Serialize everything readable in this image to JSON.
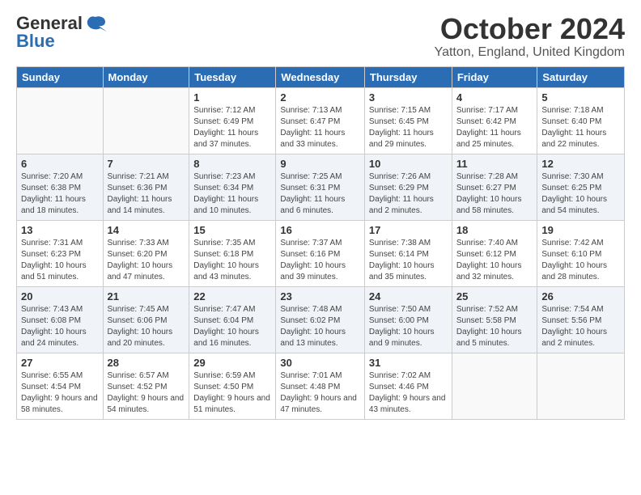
{
  "logo": {
    "general": "General",
    "blue": "Blue"
  },
  "header": {
    "month": "October 2024",
    "location": "Yatton, England, United Kingdom"
  },
  "weekdays": [
    "Sunday",
    "Monday",
    "Tuesday",
    "Wednesday",
    "Thursday",
    "Friday",
    "Saturday"
  ],
  "weeks": [
    [
      {
        "day": "",
        "info": ""
      },
      {
        "day": "",
        "info": ""
      },
      {
        "day": "1",
        "info": "Sunrise: 7:12 AM\nSunset: 6:49 PM\nDaylight: 11 hours and 37 minutes."
      },
      {
        "day": "2",
        "info": "Sunrise: 7:13 AM\nSunset: 6:47 PM\nDaylight: 11 hours and 33 minutes."
      },
      {
        "day": "3",
        "info": "Sunrise: 7:15 AM\nSunset: 6:45 PM\nDaylight: 11 hours and 29 minutes."
      },
      {
        "day": "4",
        "info": "Sunrise: 7:17 AM\nSunset: 6:42 PM\nDaylight: 11 hours and 25 minutes."
      },
      {
        "day": "5",
        "info": "Sunrise: 7:18 AM\nSunset: 6:40 PM\nDaylight: 11 hours and 22 minutes."
      }
    ],
    [
      {
        "day": "6",
        "info": "Sunrise: 7:20 AM\nSunset: 6:38 PM\nDaylight: 11 hours and 18 minutes."
      },
      {
        "day": "7",
        "info": "Sunrise: 7:21 AM\nSunset: 6:36 PM\nDaylight: 11 hours and 14 minutes."
      },
      {
        "day": "8",
        "info": "Sunrise: 7:23 AM\nSunset: 6:34 PM\nDaylight: 11 hours and 10 minutes."
      },
      {
        "day": "9",
        "info": "Sunrise: 7:25 AM\nSunset: 6:31 PM\nDaylight: 11 hours and 6 minutes."
      },
      {
        "day": "10",
        "info": "Sunrise: 7:26 AM\nSunset: 6:29 PM\nDaylight: 11 hours and 2 minutes."
      },
      {
        "day": "11",
        "info": "Sunrise: 7:28 AM\nSunset: 6:27 PM\nDaylight: 10 hours and 58 minutes."
      },
      {
        "day": "12",
        "info": "Sunrise: 7:30 AM\nSunset: 6:25 PM\nDaylight: 10 hours and 54 minutes."
      }
    ],
    [
      {
        "day": "13",
        "info": "Sunrise: 7:31 AM\nSunset: 6:23 PM\nDaylight: 10 hours and 51 minutes."
      },
      {
        "day": "14",
        "info": "Sunrise: 7:33 AM\nSunset: 6:20 PM\nDaylight: 10 hours and 47 minutes."
      },
      {
        "day": "15",
        "info": "Sunrise: 7:35 AM\nSunset: 6:18 PM\nDaylight: 10 hours and 43 minutes."
      },
      {
        "day": "16",
        "info": "Sunrise: 7:37 AM\nSunset: 6:16 PM\nDaylight: 10 hours and 39 minutes."
      },
      {
        "day": "17",
        "info": "Sunrise: 7:38 AM\nSunset: 6:14 PM\nDaylight: 10 hours and 35 minutes."
      },
      {
        "day": "18",
        "info": "Sunrise: 7:40 AM\nSunset: 6:12 PM\nDaylight: 10 hours and 32 minutes."
      },
      {
        "day": "19",
        "info": "Sunrise: 7:42 AM\nSunset: 6:10 PM\nDaylight: 10 hours and 28 minutes."
      }
    ],
    [
      {
        "day": "20",
        "info": "Sunrise: 7:43 AM\nSunset: 6:08 PM\nDaylight: 10 hours and 24 minutes."
      },
      {
        "day": "21",
        "info": "Sunrise: 7:45 AM\nSunset: 6:06 PM\nDaylight: 10 hours and 20 minutes."
      },
      {
        "day": "22",
        "info": "Sunrise: 7:47 AM\nSunset: 6:04 PM\nDaylight: 10 hours and 16 minutes."
      },
      {
        "day": "23",
        "info": "Sunrise: 7:48 AM\nSunset: 6:02 PM\nDaylight: 10 hours and 13 minutes."
      },
      {
        "day": "24",
        "info": "Sunrise: 7:50 AM\nSunset: 6:00 PM\nDaylight: 10 hours and 9 minutes."
      },
      {
        "day": "25",
        "info": "Sunrise: 7:52 AM\nSunset: 5:58 PM\nDaylight: 10 hours and 5 minutes."
      },
      {
        "day": "26",
        "info": "Sunrise: 7:54 AM\nSunset: 5:56 PM\nDaylight: 10 hours and 2 minutes."
      }
    ],
    [
      {
        "day": "27",
        "info": "Sunrise: 6:55 AM\nSunset: 4:54 PM\nDaylight: 9 hours and 58 minutes."
      },
      {
        "day": "28",
        "info": "Sunrise: 6:57 AM\nSunset: 4:52 PM\nDaylight: 9 hours and 54 minutes."
      },
      {
        "day": "29",
        "info": "Sunrise: 6:59 AM\nSunset: 4:50 PM\nDaylight: 9 hours and 51 minutes."
      },
      {
        "day": "30",
        "info": "Sunrise: 7:01 AM\nSunset: 4:48 PM\nDaylight: 9 hours and 47 minutes."
      },
      {
        "day": "31",
        "info": "Sunrise: 7:02 AM\nSunset: 4:46 PM\nDaylight: 9 hours and 43 minutes."
      },
      {
        "day": "",
        "info": ""
      },
      {
        "day": "",
        "info": ""
      }
    ]
  ]
}
